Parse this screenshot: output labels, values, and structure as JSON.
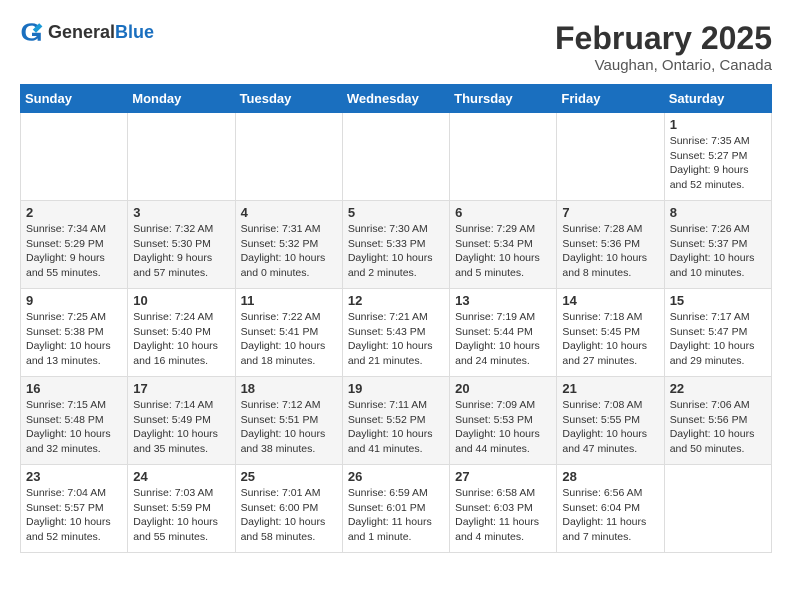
{
  "logo": {
    "general": "General",
    "blue": "Blue"
  },
  "header": {
    "month": "February 2025",
    "location": "Vaughan, Ontario, Canada"
  },
  "weekdays": [
    "Sunday",
    "Monday",
    "Tuesday",
    "Wednesday",
    "Thursday",
    "Friday",
    "Saturday"
  ],
  "weeks": [
    [
      {
        "day": "",
        "info": ""
      },
      {
        "day": "",
        "info": ""
      },
      {
        "day": "",
        "info": ""
      },
      {
        "day": "",
        "info": ""
      },
      {
        "day": "",
        "info": ""
      },
      {
        "day": "",
        "info": ""
      },
      {
        "day": "1",
        "info": "Sunrise: 7:35 AM\nSunset: 5:27 PM\nDaylight: 9 hours and 52 minutes."
      }
    ],
    [
      {
        "day": "2",
        "info": "Sunrise: 7:34 AM\nSunset: 5:29 PM\nDaylight: 9 hours and 55 minutes."
      },
      {
        "day": "3",
        "info": "Sunrise: 7:32 AM\nSunset: 5:30 PM\nDaylight: 9 hours and 57 minutes."
      },
      {
        "day": "4",
        "info": "Sunrise: 7:31 AM\nSunset: 5:32 PM\nDaylight: 10 hours and 0 minutes."
      },
      {
        "day": "5",
        "info": "Sunrise: 7:30 AM\nSunset: 5:33 PM\nDaylight: 10 hours and 2 minutes."
      },
      {
        "day": "6",
        "info": "Sunrise: 7:29 AM\nSunset: 5:34 PM\nDaylight: 10 hours and 5 minutes."
      },
      {
        "day": "7",
        "info": "Sunrise: 7:28 AM\nSunset: 5:36 PM\nDaylight: 10 hours and 8 minutes."
      },
      {
        "day": "8",
        "info": "Sunrise: 7:26 AM\nSunset: 5:37 PM\nDaylight: 10 hours and 10 minutes."
      }
    ],
    [
      {
        "day": "9",
        "info": "Sunrise: 7:25 AM\nSunset: 5:38 PM\nDaylight: 10 hours and 13 minutes."
      },
      {
        "day": "10",
        "info": "Sunrise: 7:24 AM\nSunset: 5:40 PM\nDaylight: 10 hours and 16 minutes."
      },
      {
        "day": "11",
        "info": "Sunrise: 7:22 AM\nSunset: 5:41 PM\nDaylight: 10 hours and 18 minutes."
      },
      {
        "day": "12",
        "info": "Sunrise: 7:21 AM\nSunset: 5:43 PM\nDaylight: 10 hours and 21 minutes."
      },
      {
        "day": "13",
        "info": "Sunrise: 7:19 AM\nSunset: 5:44 PM\nDaylight: 10 hours and 24 minutes."
      },
      {
        "day": "14",
        "info": "Sunrise: 7:18 AM\nSunset: 5:45 PM\nDaylight: 10 hours and 27 minutes."
      },
      {
        "day": "15",
        "info": "Sunrise: 7:17 AM\nSunset: 5:47 PM\nDaylight: 10 hours and 29 minutes."
      }
    ],
    [
      {
        "day": "16",
        "info": "Sunrise: 7:15 AM\nSunset: 5:48 PM\nDaylight: 10 hours and 32 minutes."
      },
      {
        "day": "17",
        "info": "Sunrise: 7:14 AM\nSunset: 5:49 PM\nDaylight: 10 hours and 35 minutes."
      },
      {
        "day": "18",
        "info": "Sunrise: 7:12 AM\nSunset: 5:51 PM\nDaylight: 10 hours and 38 minutes."
      },
      {
        "day": "19",
        "info": "Sunrise: 7:11 AM\nSunset: 5:52 PM\nDaylight: 10 hours and 41 minutes."
      },
      {
        "day": "20",
        "info": "Sunrise: 7:09 AM\nSunset: 5:53 PM\nDaylight: 10 hours and 44 minutes."
      },
      {
        "day": "21",
        "info": "Sunrise: 7:08 AM\nSunset: 5:55 PM\nDaylight: 10 hours and 47 minutes."
      },
      {
        "day": "22",
        "info": "Sunrise: 7:06 AM\nSunset: 5:56 PM\nDaylight: 10 hours and 50 minutes."
      }
    ],
    [
      {
        "day": "23",
        "info": "Sunrise: 7:04 AM\nSunset: 5:57 PM\nDaylight: 10 hours and 52 minutes."
      },
      {
        "day": "24",
        "info": "Sunrise: 7:03 AM\nSunset: 5:59 PM\nDaylight: 10 hours and 55 minutes."
      },
      {
        "day": "25",
        "info": "Sunrise: 7:01 AM\nSunset: 6:00 PM\nDaylight: 10 hours and 58 minutes."
      },
      {
        "day": "26",
        "info": "Sunrise: 6:59 AM\nSunset: 6:01 PM\nDaylight: 11 hours and 1 minute."
      },
      {
        "day": "27",
        "info": "Sunrise: 6:58 AM\nSunset: 6:03 PM\nDaylight: 11 hours and 4 minutes."
      },
      {
        "day": "28",
        "info": "Sunrise: 6:56 AM\nSunset: 6:04 PM\nDaylight: 11 hours and 7 minutes."
      },
      {
        "day": "",
        "info": ""
      }
    ]
  ]
}
